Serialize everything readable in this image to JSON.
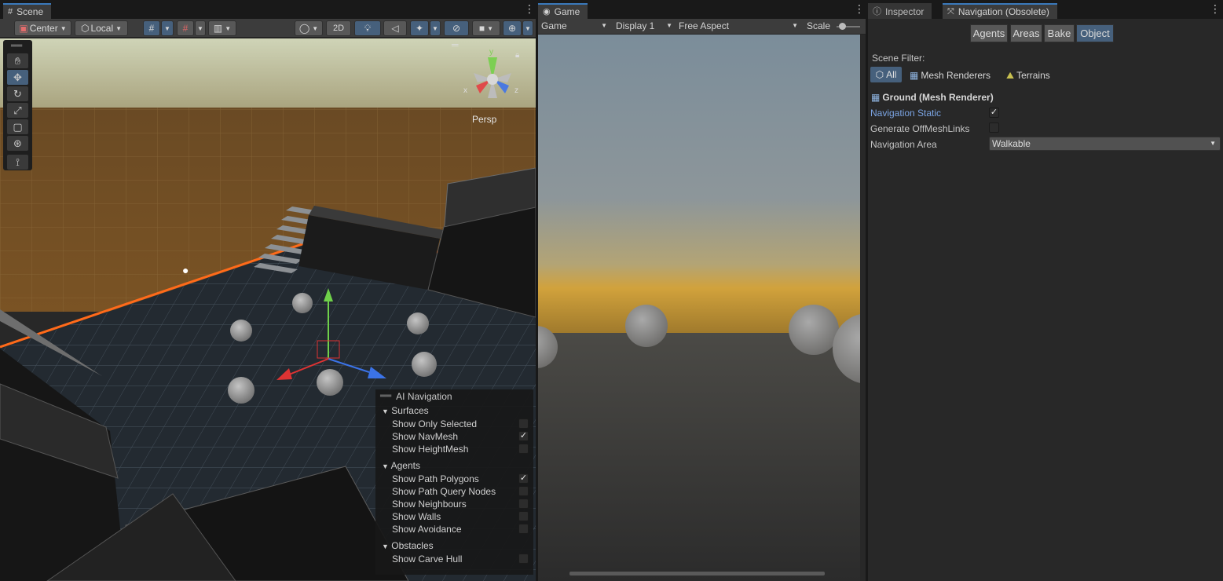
{
  "scene": {
    "tab": "Scene",
    "pivot": "Center",
    "space": "Local",
    "mode2d": "2D",
    "persp": "Persp",
    "gizmo_axes": {
      "x": "x",
      "y": "y",
      "z": "z"
    },
    "nav_overlay": {
      "title": "AI Navigation",
      "sections": [
        {
          "name": "Surfaces",
          "rows": [
            {
              "label": "Show Only Selected",
              "checked": false
            },
            {
              "label": "Show NavMesh",
              "checked": true
            },
            {
              "label": "Show HeightMesh",
              "checked": false
            }
          ]
        },
        {
          "name": "Agents",
          "rows": [
            {
              "label": "Show Path Polygons",
              "checked": true
            },
            {
              "label": "Show Path Query Nodes",
              "checked": false
            },
            {
              "label": "Show Neighbours",
              "checked": false
            },
            {
              "label": "Show Walls",
              "checked": false
            },
            {
              "label": "Show Avoidance",
              "checked": false
            }
          ]
        },
        {
          "name": "Obstacles",
          "rows": [
            {
              "label": "Show Carve Hull",
              "checked": false
            }
          ]
        }
      ]
    }
  },
  "game": {
    "tab": "Game",
    "mode": "Game",
    "display": "Display 1",
    "aspect": "Free Aspect",
    "scale_label": "Scale"
  },
  "inspector": {
    "tab_inspector": "Inspector",
    "tab_navigation": "Navigation (Obsolete)",
    "nav_tabs": [
      "Agents",
      "Areas",
      "Bake",
      "Object"
    ],
    "selected_nav_tab": "Object",
    "scene_filter_label": "Scene Filter:",
    "filters": [
      "All",
      "Mesh Renderers",
      "Terrains"
    ],
    "object_title": "Ground (Mesh Renderer)",
    "navigation_static_label": "Navigation Static",
    "navigation_static": true,
    "offmesh_label": "Generate OffMeshLinks",
    "offmesh": false,
    "area_label": "Navigation Area",
    "area_value": "Walkable"
  },
  "colors": {
    "accent": "#46607c",
    "tab_highlight": "#3a79bb",
    "link_label": "#7ba4e3",
    "navmesh_outline": "#ff6a1a"
  }
}
